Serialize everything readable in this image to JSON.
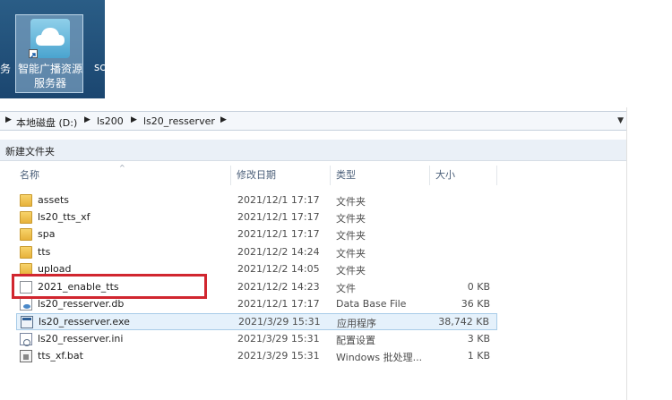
{
  "desktop": {
    "left_partial_text": "务",
    "right_partial_text": "sc",
    "shortcut": {
      "label_line1": "智能广播资源",
      "label_line2": "服务器"
    }
  },
  "address_bar": {
    "path": [
      "本地磁盘 (D:)",
      "ls200",
      "ls20_resserver"
    ],
    "separator": "▶",
    "dropdown": "▼"
  },
  "toolbar": {
    "new_folder": "新建文件夹"
  },
  "columns": {
    "name": "名称",
    "date": "修改日期",
    "type": "类型",
    "size": "大小",
    "sort_arrow": "^"
  },
  "files": [
    {
      "name": "assets",
      "date": "2021/12/1 17:17",
      "type": "文件夹",
      "size": "",
      "icon": "folder-icon"
    },
    {
      "name": "ls20_tts_xf",
      "date": "2021/12/1 17:17",
      "type": "文件夹",
      "size": "",
      "icon": "folder-icon"
    },
    {
      "name": "spa",
      "date": "2021/12/1 17:17",
      "type": "文件夹",
      "size": "",
      "icon": "folder-icon"
    },
    {
      "name": "tts",
      "date": "2021/12/2 14:24",
      "type": "文件夹",
      "size": "",
      "icon": "folder-icon"
    },
    {
      "name": "upload",
      "date": "2021/12/2 14:05",
      "type": "文件夹",
      "size": "",
      "icon": "folder-icon"
    },
    {
      "name": "2021_enable_tts",
      "date": "2021/12/2 14:23",
      "type": "文件",
      "size": "0 KB",
      "icon": "file-icon"
    },
    {
      "name": "ls20_resserver.db",
      "date": "2021/12/1 17:17",
      "type": "Data Base File",
      "size": "36 KB",
      "icon": "db-file-icon"
    },
    {
      "name": "ls20_resserver.exe",
      "date": "2021/3/29 15:31",
      "type": "应用程序",
      "size": "38,742 KB",
      "icon": "exe-icon",
      "selected": true
    },
    {
      "name": "ls20_resserver.ini",
      "date": "2021/3/29 15:31",
      "type": "配置设置",
      "size": "3 KB",
      "icon": "ini-icon"
    },
    {
      "name": "tts_xf.bat",
      "date": "2021/3/29 15:31",
      "type": "Windows 批处理...",
      "size": "1 KB",
      "icon": "bat-icon"
    }
  ],
  "colors": {
    "highlight": "#d1262f",
    "selection": "#e5f1fb",
    "folder": "#e7b23b"
  }
}
